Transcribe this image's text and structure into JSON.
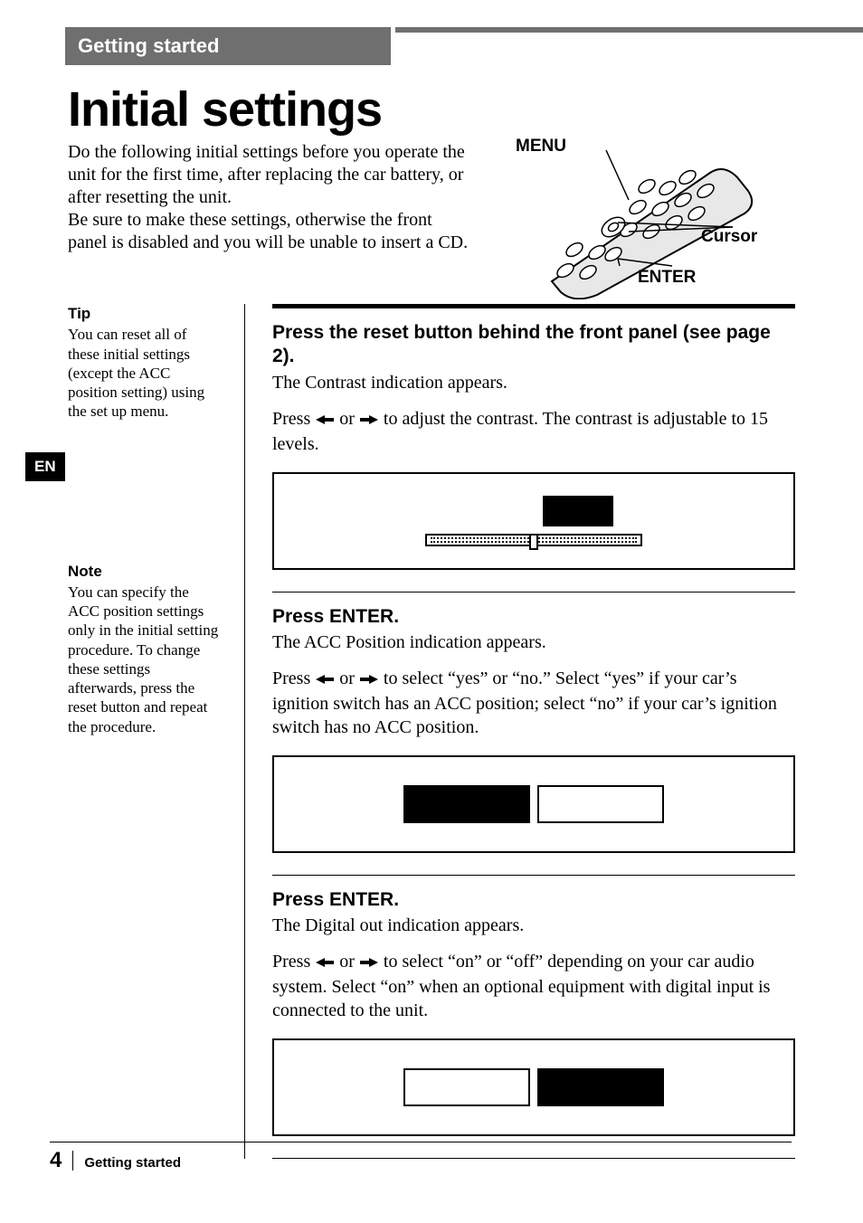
{
  "header": {
    "section": "Getting started"
  },
  "title": "Initial settings",
  "intro": "Do the following initial settings before you operate the unit for the first time, after replacing the car battery, or after resetting the unit.\nBe sure to make these settings, otherwise the front panel is disabled and you will be unable to insert a CD.",
  "remote_labels": {
    "menu": "MENU",
    "cursor": "Cursor",
    "enter": "ENTER"
  },
  "language_tab": "EN",
  "sidebar": {
    "tip": {
      "heading": "Tip",
      "body": "You can reset all of these initial settings (except the ACC position setting) using the set up menu."
    },
    "note": {
      "heading": "Note",
      "body": "You can specify the ACC position settings only in the initial setting procedure. To change these settings afterwards, press the reset button and repeat the procedure."
    }
  },
  "steps": [
    {
      "title": "Press the reset button behind the front panel (see page 2).",
      "line1": "The Contrast indication appears.",
      "line2_prefix": "Press ",
      "line2_mid": " or ",
      "line2_suffix": " to adjust the contrast.  The contrast is adjustable to 15 levels.",
      "display_type": "contrast"
    },
    {
      "title": "Press ENTER.",
      "line1": "The ACC Position indication appears.",
      "line2_prefix": "Press ",
      "line2_mid": " or ",
      "line2_suffix": " to select “yes” or “no.”  Select “yes” if your car’s ignition switch has an ACC position; select “no” if your car’s ignition switch has no ACC position.",
      "display_type": "twocell_left"
    },
    {
      "title": "Press ENTER.",
      "line1": "The Digital out indication appears.",
      "line2_prefix": "Press ",
      "line2_mid": " or ",
      "line2_suffix": " to select “on” or “off” depending on your car audio system. Select “on” when an optional equipment with digital input is connected to the unit.",
      "display_type": "twocell_right"
    }
  ],
  "footer": {
    "page_number": "4",
    "section": "Getting started"
  }
}
